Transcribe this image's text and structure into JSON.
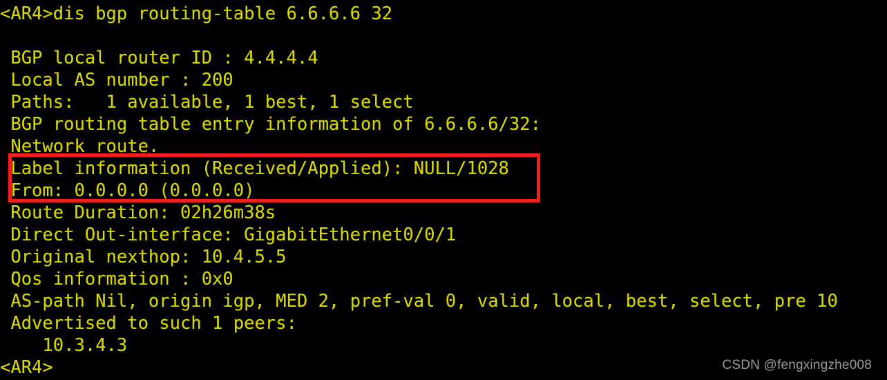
{
  "terminal": {
    "background_color": "#000000",
    "text_color": "#d7d700",
    "prompt_command_line": "<AR4>dis bgp routing-table 6.6.6.6 32",
    "blank_line": " ",
    "lines": [
      " BGP local router ID : 4.4.4.4",
      " Local AS number : 200",
      " Paths:   1 available, 1 best, 1 select",
      " BGP routing table entry information of 6.6.6.6/32:",
      " Network route.",
      " Label information (Received/Applied): NULL/1028",
      " From: 0.0.0.0 (0.0.0.0)",
      " Route Duration: 02h26m38s",
      " Direct Out-interface: GigabitEthernet0/0/1",
      " Original nexthop: 10.4.5.5",
      " Qos information : 0x0",
      " AS-path Nil, origin igp, MED 2, pref-val 0, valid, local, best, select, pre 10",
      " Advertised to such 1 peers:",
      "    10.3.4.3"
    ],
    "trailing_prompt": "<AR4>"
  },
  "annotation": {
    "highlight_color": "#f41c1c",
    "highlighted_lines": [
      " Label information (Received/Applied): NULL/1028",
      " From: 0.0.0.0 (0.0.0.0)"
    ]
  },
  "watermark": {
    "text": "CSDN @fengxingzhe008",
    "color": "#9a9a9a"
  }
}
